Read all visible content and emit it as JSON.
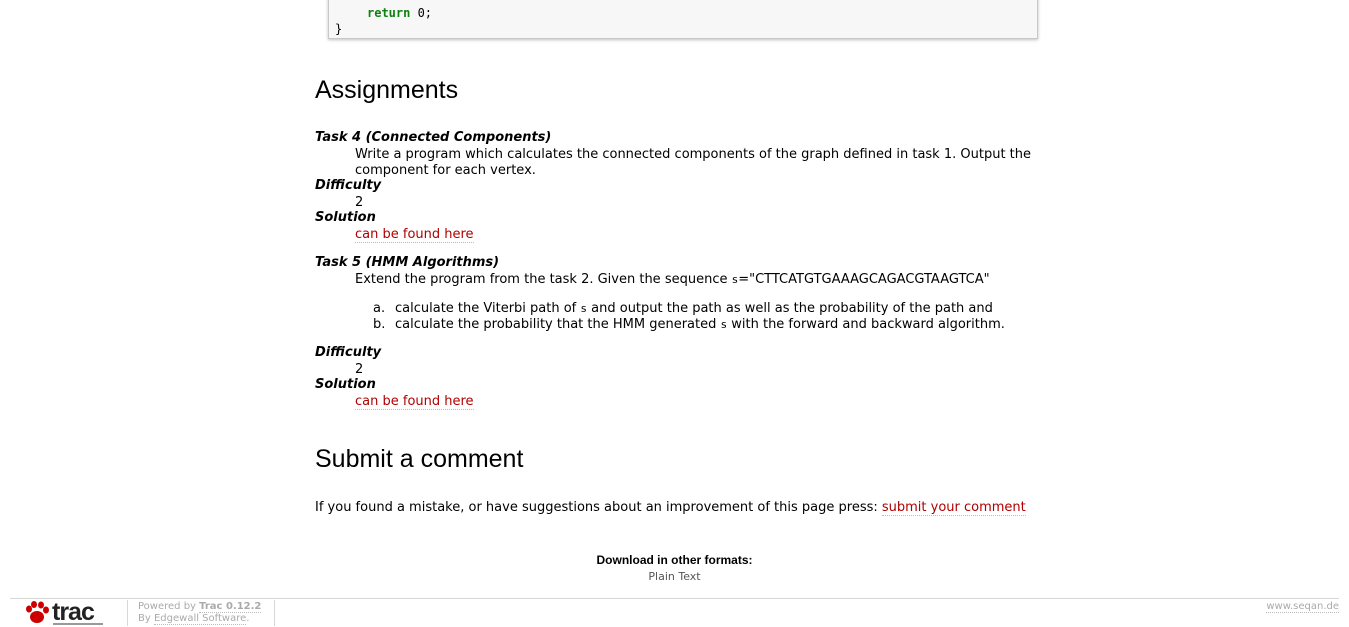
{
  "code": {
    "keyword": "return",
    "rest": " 0;",
    "close": "}"
  },
  "assignments": {
    "heading": "Assignments",
    "task4": {
      "title": "Task 4 (Connected Components)",
      "desc_line1": "Write a program which calculates the connected components of the graph defined in task 1. Output the",
      "desc_line2": "component for each vertex.",
      "difficulty_label": "Difficulty",
      "difficulty_value": "2",
      "solution_label": "Solution",
      "solution_link": "can be found here"
    },
    "task5": {
      "title": "Task 5 (HMM Algorithms)",
      "desc_prefix": "Extend the program from the task 2. Given the sequence ",
      "desc_var": "s",
      "desc_suffix": "=\"CTTCATGTGAAAGCAGACGTAAGTCA\"",
      "items": [
        {
          "marker": "a.",
          "pre": "calculate the Viterbi path of ",
          "var": "s",
          "post": " and output the path as well as the probability of the path and"
        },
        {
          "marker": "b.",
          "pre": "calculate the probability that the HMM generated ",
          "var": "s",
          "post": " with the forward and backward algorithm."
        }
      ],
      "difficulty_label": "Difficulty",
      "difficulty_value": "2",
      "solution_label": "Solution",
      "solution_link": "can be found here"
    }
  },
  "comment": {
    "heading": "Submit a comment",
    "text": "If you found a mistake, or have suggestions about an improvement of this page press: ",
    "link": "submit your comment"
  },
  "download": {
    "title": "Download in other formats:",
    "plain_text": "Plain Text"
  },
  "footer": {
    "logo_text": "trac",
    "powered_prefix": "Powered by ",
    "trac_version": "Trac 0.12.2",
    "by_prefix": "By ",
    "edgewall": "Edgewall Software",
    "by_suffix": ".",
    "site": "www.seqan.de"
  }
}
